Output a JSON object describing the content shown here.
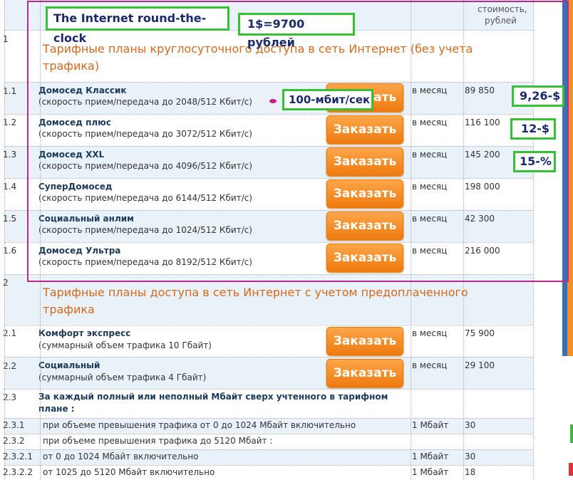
{
  "header": {
    "cost_label_1": "стоимость,",
    "cost_label_2": "рублей"
  },
  "annotations": {
    "title": "The Internet round-the-clock",
    "rate": "1$=9700 рублей",
    "speed": "100-мбит/сек",
    "usd1": "9,26-$",
    "usd2": "12-$",
    "pct": "15-%"
  },
  "sections": [
    {
      "num": "1",
      "title": "Тарифные планы круглосуточного доступа в сеть Интернет (без учета трафика)"
    },
    {
      "num": "2",
      "title": "Тарифные планы доступа в сеть Интернет с учетом предоплаченного трафика"
    }
  ],
  "plans": [
    {
      "num": "1.1",
      "name": "Домосед Классик",
      "sub": "(скорость прием/передача до 2048/512 Кбит/с)",
      "period": "в месяц",
      "price": "89 850",
      "button": "Заказать"
    },
    {
      "num": "1.2",
      "name": "Домосед плюс",
      "sub": "(скорость прием/передача до 3072/512 Кбит/с)",
      "period": "в месяц",
      "price": "116 100",
      "button": "Заказать"
    },
    {
      "num": "1.3",
      "name": "Домосед XXL",
      "sub": "(скорость прием/передача до 4096/512 Кбит/с)",
      "period": "в месяц",
      "price": "145 200",
      "button": "Заказать"
    },
    {
      "num": "1.4",
      "name": "СуперДомосед",
      "sub": "(скорость прием/передача до 6144/512 Кбит/с)",
      "period": "в месяц",
      "price": "198 000",
      "button": "Заказать"
    },
    {
      "num": "1.5",
      "name": "Социальный анлим",
      "sub": "(скорость прием/передача до 1024/512 Кбит/с)",
      "period": "в месяц",
      "price": "42 300",
      "button": "Заказать"
    },
    {
      "num": "1.6",
      "name": "Домосед Ультра",
      "sub": "(скорость прием/передача до 8192/512 Кбит/с)",
      "period": "в месяц",
      "price": "216 000",
      "button": "Заказать"
    },
    {
      "num": "2.1",
      "name": "Комфорт экспресс",
      "sub": "(суммарный объем трафика 10 Гбайт)",
      "period": "в месяц",
      "price": "75 900",
      "button": "Заказать"
    },
    {
      "num": "2.2",
      "name": "Социальный",
      "sub": "(суммарный объем трафика 4 Гбайт)",
      "period": "в месяц",
      "price": "29 100",
      "button": "Заказать"
    }
  ],
  "extra": {
    "num": "2.3",
    "title_1": "За каждый полный или неполный Мбайт сверх учтенного в тарифном",
    "title_2": "плане :",
    "rows": [
      {
        "num": "2.3.1",
        "text": "при объеме превышения трафика от 0 до 1024 Мбайт включительно",
        "unit": "1 Мбайт",
        "price": "30"
      },
      {
        "num": "2.3.2",
        "text": "при объеме превышения трафика до 5120 Мбайт :",
        "unit": "",
        "price": ""
      },
      {
        "num": "2.3.2.1",
        "text": "от 0 до 1024 Мбайт включительно",
        "unit": "1 Мбайт",
        "price": "30"
      },
      {
        "num": "2.3.2.2",
        "text": "от 1025 до 5120 Мбайт включительно",
        "unit": "1 Мбайт",
        "price": "18"
      }
    ]
  }
}
